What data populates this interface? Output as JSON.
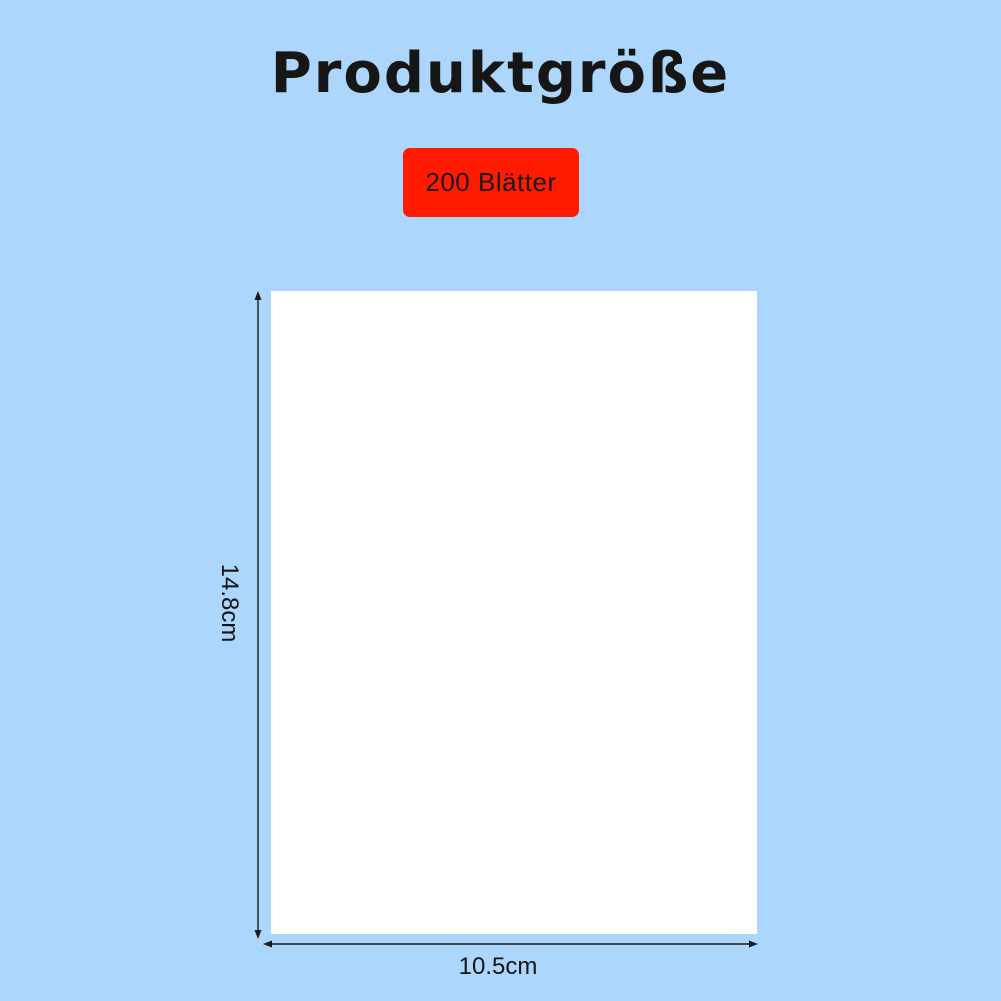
{
  "title": "Produktgröße",
  "badge": {
    "label": "200 Blätter",
    "color": "#ff1a00"
  },
  "dimensions": {
    "width_label": "10.5cm",
    "height_label": "14.8cm"
  },
  "colors": {
    "background": "#acd6fb",
    "sheet": "#ffffff",
    "text": "#161616"
  }
}
